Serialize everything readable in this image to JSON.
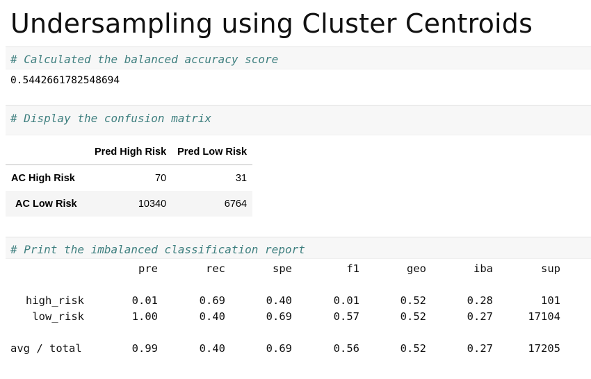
{
  "heading": "Undersampling using Cluster Centroids",
  "cells": {
    "balanced_comment": "# Calculated the balanced accuracy score",
    "balanced_output": "0.5442661782548694",
    "confusion_comment": "# Display the confusion matrix",
    "report_comment": "# Print the imbalanced classification report"
  },
  "confusion_matrix": {
    "columns": [
      "Pred High Risk",
      "Pred Low Risk"
    ],
    "rows": [
      {
        "label": "AC High Risk",
        "values": [
          "70",
          "31"
        ]
      },
      {
        "label": "AC Low Risk",
        "values": [
          "10340",
          "6764"
        ]
      }
    ]
  },
  "report": {
    "headers": [
      "pre",
      "rec",
      "spe",
      "f1",
      "geo",
      "iba",
      "sup"
    ],
    "rows": [
      {
        "label": "high_risk",
        "values": [
          "0.01",
          "0.69",
          "0.40",
          "0.01",
          "0.52",
          "0.28",
          "101"
        ]
      },
      {
        "label": "low_risk",
        "values": [
          "1.00",
          "0.40",
          "0.69",
          "0.57",
          "0.52",
          "0.27",
          "17104"
        ]
      },
      {
        "label": "avg / total",
        "values": [
          "0.99",
          "0.40",
          "0.69",
          "0.56",
          "0.52",
          "0.27",
          "17205"
        ]
      }
    ]
  }
}
